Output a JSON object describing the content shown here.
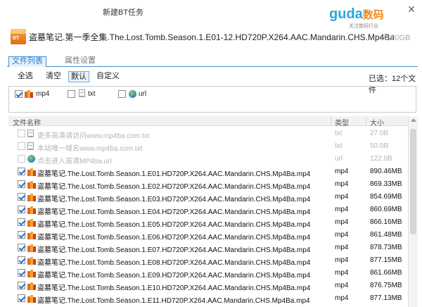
{
  "window": {
    "title": "新建BT任务"
  },
  "logo": {
    "brand": "guda",
    "brand_cn": "数码",
    "slogan": "关注数码行业"
  },
  "task": {
    "name": "盗墓笔记.第一季全集.The.Lost.Tomb.Season.1.E01-12.HD720P.X264.AAC.Mandarin.CHS.Mp4Ba",
    "total_size": "10.20GB",
    "icon_label": "BT"
  },
  "tabs": [
    {
      "label": "文件列表",
      "active": true
    },
    {
      "label": "属性设置",
      "active": false
    }
  ],
  "filters": [
    {
      "label": "全选",
      "selected": false
    },
    {
      "label": "清空",
      "selected": false
    },
    {
      "label": "默认",
      "selected": true
    },
    {
      "label": "自定义",
      "selected": false
    }
  ],
  "selected_info": "已选：12个文件",
  "types": [
    {
      "label": "mp4",
      "checked": true,
      "icon": "mp4-icon"
    },
    {
      "label": "txt",
      "checked": false,
      "icon": "txt-icon"
    },
    {
      "label": "url",
      "checked": false,
      "icon": "url-icon"
    }
  ],
  "columns": {
    "name": "文件名称",
    "type": "类型",
    "size": "大小"
  },
  "files": [
    {
      "name": "更多高清请访问www.mp4ba.com.txt",
      "type": "txt",
      "size": "27.0B",
      "checked": false,
      "icon": "txt-icon",
      "muted": true
    },
    {
      "name": "本站唯一域名www.mp4ba.com.txt",
      "type": "txt",
      "size": "50.0B",
      "checked": false,
      "icon": "txt-icon",
      "muted": true
    },
    {
      "name": "点击进入高清MP4ba.url",
      "type": "url",
      "size": "122.0B",
      "checked": false,
      "icon": "url-icon",
      "muted": true
    },
    {
      "name": "盗墓笔记.The.Lost.Tomb.Season.1.E01.HD720P.X264.AAC.Mandarin.CHS.Mp4Ba.mp4",
      "type": "mp4",
      "size": "890.46MB",
      "checked": true,
      "icon": "mp4-icon",
      "muted": false
    },
    {
      "name": "盗墓笔记.The.Lost.Tomb.Season.1.E02.HD720P.X264.AAC.Mandarin.CHS.Mp4Ba.mp4",
      "type": "mp4",
      "size": "869.33MB",
      "checked": true,
      "icon": "mp4-icon",
      "muted": false
    },
    {
      "name": "盗墓笔记.The.Lost.Tomb.Season.1.E03.HD720P.X264.AAC.Mandarin.CHS.Mp4Ba.mp4",
      "type": "mp4",
      "size": "854.69MB",
      "checked": true,
      "icon": "mp4-icon",
      "muted": false
    },
    {
      "name": "盗墓笔记.The.Lost.Tomb.Season.1.E04.HD720P.X264.AAC.Mandarin.CHS.Mp4Ba.mp4",
      "type": "mp4",
      "size": "860.69MB",
      "checked": true,
      "icon": "mp4-icon",
      "muted": false
    },
    {
      "name": "盗墓笔记.The.Lost.Tomb.Season.1.E05.HD720P.X264.AAC.Mandarin.CHS.Mp4Ba.mp4",
      "type": "mp4",
      "size": "866.16MB",
      "checked": true,
      "icon": "mp4-icon",
      "muted": false
    },
    {
      "name": "盗墓笔记.The.Lost.Tomb.Season.1.E06.HD720P.X264.AAC.Mandarin.CHS.Mp4Ba.mp4",
      "type": "mp4",
      "size": "861.48MB",
      "checked": true,
      "icon": "mp4-icon",
      "muted": false
    },
    {
      "name": "盗墓笔记.The.Lost.Tomb.Season.1.E07.HD720P.X264.AAC.Mandarin.CHS.Mp4Ba.mp4",
      "type": "mp4",
      "size": "878.73MB",
      "checked": true,
      "icon": "mp4-icon",
      "muted": false
    },
    {
      "name": "盗墓笔记.The.Lost.Tomb.Season.1.E08.HD720P.X264.AAC.Mandarin.CHS.Mp4Ba.mp4",
      "type": "mp4",
      "size": "877.15MB",
      "checked": true,
      "icon": "mp4-icon",
      "muted": false
    },
    {
      "name": "盗墓笔记.The.Lost.Tomb.Season.1.E09.HD720P.X264.AAC.Mandarin.CHS.Mp4Ba.mp4",
      "type": "mp4",
      "size": "861.66MB",
      "checked": true,
      "icon": "mp4-icon",
      "muted": false
    },
    {
      "name": "盗墓笔记.The.Lost.Tomb.Season.1.E10.HD720P.X264.AAC.Mandarin.CHS.Mp4Ba.mp4",
      "type": "mp4",
      "size": "876.75MB",
      "checked": true,
      "icon": "mp4-icon",
      "muted": false
    },
    {
      "name": "盗墓笔记.The.Lost.Tomb.Season.1.E11.HD720P.X264.AAC.Mandarin.CHS.Mp4Ba.mp4",
      "type": "mp4",
      "size": "877.13MB",
      "checked": true,
      "icon": "mp4-icon",
      "muted": false
    }
  ],
  "colors": {
    "accent": "#2a7bc8",
    "brand_blue": "#2aa8df",
    "brand_orange": "#f08a1c",
    "muted_text": "#b4b4b4"
  }
}
